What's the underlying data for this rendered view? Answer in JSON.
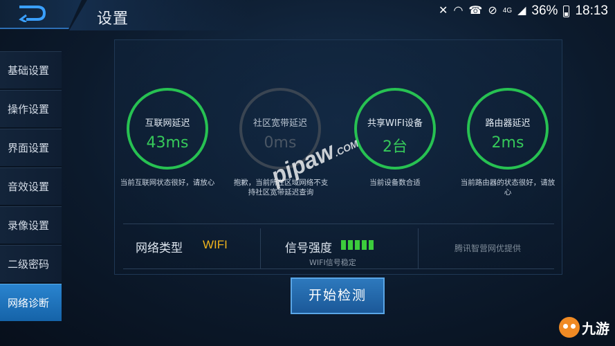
{
  "status_bar": {
    "network_type": "4G",
    "battery": "36%",
    "time": "18:13"
  },
  "header": {
    "title": "设置"
  },
  "sidebar": {
    "items": [
      {
        "label": "基础设置"
      },
      {
        "label": "操作设置"
      },
      {
        "label": "界面设置"
      },
      {
        "label": "音效设置"
      },
      {
        "label": "录像设置"
      },
      {
        "label": "二级密码"
      },
      {
        "label": "网络诊断",
        "active": true
      }
    ]
  },
  "gauges": [
    {
      "label": "互联网延迟",
      "value": "43ms",
      "desc": "当前互联网状态很好，请放心",
      "active": true
    },
    {
      "label": "社区宽带延迟",
      "value": "0ms",
      "desc": "抱歉，当前所在区域网络不支持社区宽带延迟查询",
      "active": false
    },
    {
      "label": "共享WIFI设备",
      "value": "2台",
      "desc": "当前设备数合适",
      "active": true
    },
    {
      "label": "路由器延迟",
      "value": "2ms",
      "desc": "当前路由器的状态很好，请放心",
      "active": true
    }
  ],
  "network_info": {
    "type_label": "网络类型",
    "type_value": "WIFI",
    "signal_label": "信号强度",
    "signal_level": 5,
    "signal_max": 5,
    "signal_note": "WIFI信号稳定",
    "provider": "腾讯智营网优提供"
  },
  "actions": {
    "start_label": "开始检测"
  },
  "colors": {
    "good": "#36c95a",
    "accent": "#f0b41c",
    "active_tab": "#2a84cf"
  },
  "watermark": {
    "text": "pipaw",
    "suffix": ".COM"
  },
  "corner_brand": "九游"
}
